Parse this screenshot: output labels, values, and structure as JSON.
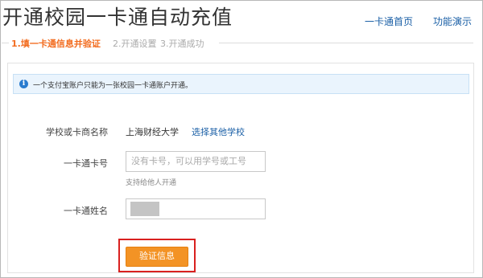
{
  "header": {
    "title": "开通校园一卡通自动充值",
    "nav": {
      "home": "一卡通首页",
      "demo": "功能演示"
    }
  },
  "steps": [
    {
      "label": "1.填一卡通信息并验证",
      "state": "active"
    },
    {
      "label": "2.开通设置",
      "state": "inactive"
    },
    {
      "label": "3.开通成功",
      "state": "inactive"
    }
  ],
  "notice": {
    "icon": "info-icon",
    "text": "一个支付宝账户只能为一张校园一卡通账户开通。"
  },
  "form": {
    "school_label": "学校或卡商名称",
    "school_value": "上海财经大学",
    "school_link": "选择其他学校",
    "card_label": "一卡通卡号",
    "card_placeholder": "没有卡号，可以用学号或工号",
    "card_value": "",
    "card_hint": "支持给他人开通",
    "name_label": "一卡通姓名",
    "name_value": ""
  },
  "submit": {
    "label": "验证信息"
  },
  "colors": {
    "accent": "#f39325",
    "link": "#1a5fa6",
    "active_step": "#f26c1f",
    "highlight": "#d9201f"
  }
}
